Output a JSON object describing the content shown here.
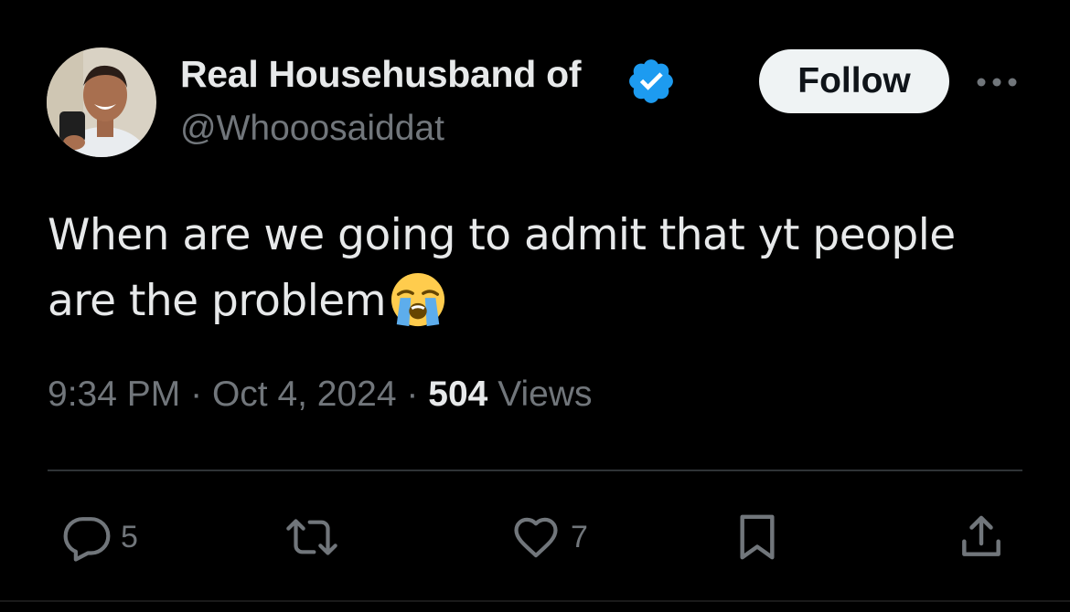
{
  "author": {
    "display_name": "Real Househusband of",
    "handle": "@Whooosaiddat",
    "verified": true
  },
  "actions_top": {
    "follow_label": "Follow"
  },
  "tweet": {
    "lines": [
      "When are we going to admit that yt people",
      "are the problem"
    ],
    "emoji": "loudly-crying-face"
  },
  "meta": {
    "time": "9:34 PM",
    "date": "Oct 4, 2024",
    "separator": "·",
    "views_count": "504",
    "views_label": "Views"
  },
  "engagement": {
    "replies": "5",
    "likes": "7"
  },
  "colors": {
    "background": "#000000",
    "text": "#e7e9ea",
    "muted": "#71767b",
    "verified_blue": "#1d9bf0",
    "divider": "#2f3336"
  }
}
